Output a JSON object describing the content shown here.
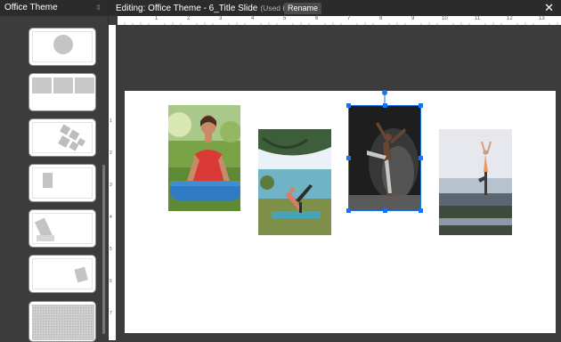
{
  "sidebar": {
    "title": "Office Theme",
    "chevron_icon": "up-down-chevron-icon",
    "layouts": [
      {
        "name": "layout-circle"
      },
      {
        "name": "layout-three-panels"
      },
      {
        "name": "layout-diamonds"
      },
      {
        "name": "layout-small-rect"
      },
      {
        "name": "layout-tilted-phone"
      },
      {
        "name": "layout-tilted-card"
      },
      {
        "name": "layout-full-texture"
      }
    ]
  },
  "header": {
    "editing_title": "Editing: Office Theme - 6_Title Slide",
    "used_by": "(Used by 1 slide)",
    "rename_label": "Rename",
    "close_glyph": "✕"
  },
  "ruler": {
    "top_ticks": [
      "1",
      "2",
      "3",
      "4",
      "5",
      "6",
      "7",
      "8",
      "9",
      "10",
      "11",
      "12",
      "13"
    ],
    "left_ticks": [
      "1",
      "2",
      "3",
      "4",
      "5",
      "6",
      "7"
    ]
  },
  "colors": {
    "selection": "#1a73e8",
    "background": "#3c3c3c",
    "toolbar": "#2b2b2b"
  },
  "slide": {
    "photos": [
      {
        "name": "photo-woman-yoga-mat"
      },
      {
        "name": "photo-yoga-beach-pose"
      },
      {
        "name": "photo-dancer-dark"
      },
      {
        "name": "photo-yoga-tree-pose"
      }
    ]
  }
}
